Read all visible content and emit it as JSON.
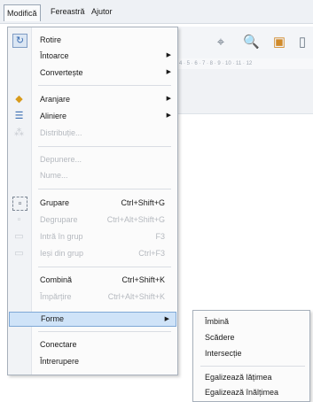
{
  "menubar": {
    "items": [
      {
        "label": "Modifică"
      },
      {
        "label": "Fereastră"
      },
      {
        "label": "Ajutor"
      }
    ]
  },
  "background": {
    "ruler_text": "4 · 5 · 6 · 7 · 8 · 9 · 10 · 11 · 12"
  },
  "menu": {
    "items": [
      {
        "label": "Rotire",
        "icon": "rotate-icon"
      },
      {
        "label": "Întoarce"
      },
      {
        "label": "Convertește"
      },
      {
        "label": "Aranjare",
        "icon": "arrange-icon"
      },
      {
        "label": "Aliniere",
        "icon": "align-icon"
      },
      {
        "label": "Distribuție..."
      },
      {
        "label": "Depunere..."
      },
      {
        "label": "Nume..."
      },
      {
        "label": "Grupare",
        "shortcut": "Ctrl+Shift+G",
        "icon": "group-icon"
      },
      {
        "label": "Degrupare",
        "shortcut": "Ctrl+Alt+Shift+G"
      },
      {
        "label": "Intră în grup",
        "shortcut": "F3"
      },
      {
        "label": "Ieși din grup",
        "shortcut": "Ctrl+F3"
      },
      {
        "label": "Combină",
        "shortcut": "Ctrl+Shift+K"
      },
      {
        "label": "Împărțire",
        "shortcut": "Ctrl+Alt+Shift+K"
      },
      {
        "label": "Forme"
      },
      {
        "label": "Conectare"
      },
      {
        "label": "Întrerupere"
      }
    ]
  },
  "submenu": {
    "items": [
      {
        "label": "Îmbină"
      },
      {
        "label": "Scădere"
      },
      {
        "label": "Intersecție"
      },
      {
        "label": "Egalizează lățimea"
      },
      {
        "label": "Egalizează înălțimea"
      }
    ]
  }
}
